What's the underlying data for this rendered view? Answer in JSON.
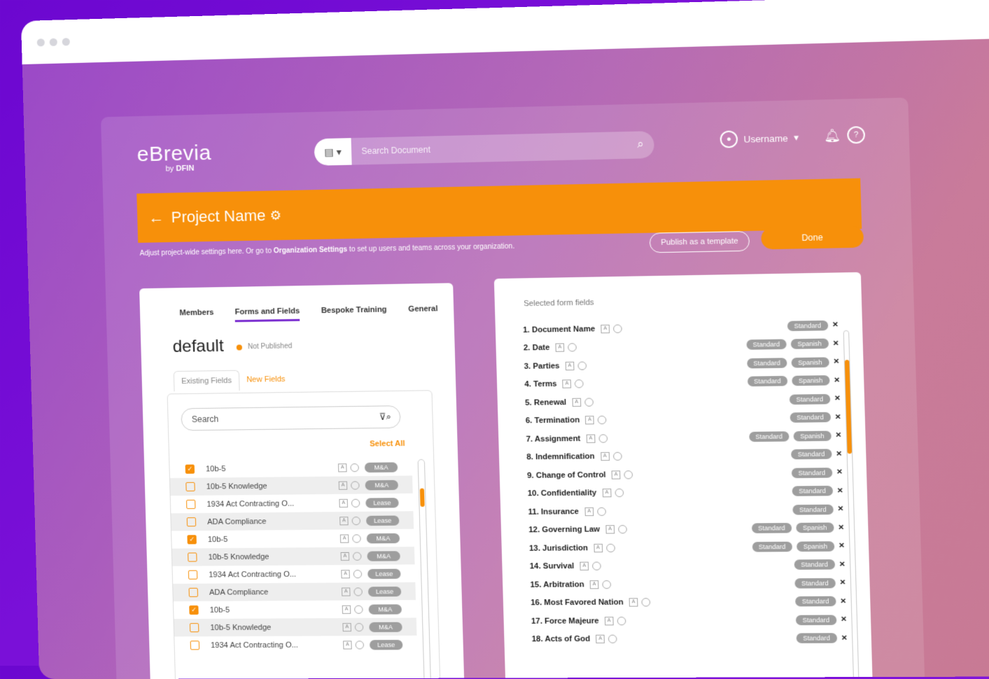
{
  "app": {
    "logo_main": "eBrevia",
    "logo_by": "by",
    "logo_brand": "DFIN"
  },
  "search": {
    "placeholder": "Search Document"
  },
  "user": {
    "name": "Username"
  },
  "project": {
    "name": "Project Name"
  },
  "hint": {
    "before": "Adjust project-wide settings here. Or go to ",
    "link": "Organization Settings",
    "after": " to set up users and teams across your organization."
  },
  "buttons": {
    "publish": "Publish as a template",
    "done": "Done"
  },
  "tabs": [
    "Members",
    "Forms and Fields",
    "Bespoke Training",
    "General"
  ],
  "form": {
    "name": "default",
    "status": "Not Published"
  },
  "subtabs": {
    "existing": "Existing Fields",
    "new": "New Fields"
  },
  "left_search": {
    "placeholder": "Search"
  },
  "select_all": "Select All",
  "fields_list": [
    {
      "label": "10b-5",
      "checked": true,
      "tag": "M&A"
    },
    {
      "label": "10b-5 Knowledge",
      "checked": false,
      "tag": "M&A"
    },
    {
      "label": "1934 Act Contracting O...",
      "checked": false,
      "tag": "Lease"
    },
    {
      "label": "ADA Compliance",
      "checked": false,
      "tag": "Lease"
    },
    {
      "label": "10b-5",
      "checked": true,
      "tag": "M&A"
    },
    {
      "label": "10b-5 Knowledge",
      "checked": false,
      "tag": "M&A"
    },
    {
      "label": "1934 Act Contracting O...",
      "checked": false,
      "tag": "Lease"
    },
    {
      "label": "ADA Compliance",
      "checked": false,
      "tag": "Lease"
    },
    {
      "label": "10b-5",
      "checked": true,
      "tag": "M&A"
    },
    {
      "label": "10b-5 Knowledge",
      "checked": false,
      "tag": "M&A"
    },
    {
      "label": "1934 Act Contracting O...",
      "checked": false,
      "tag": "Lease"
    }
  ],
  "selected": {
    "title": "Selected form fields",
    "items": [
      {
        "label": "1. Document Name",
        "tags": [
          "Standard"
        ]
      },
      {
        "label": "2. Date",
        "tags": [
          "Standard",
          "Spanish"
        ]
      },
      {
        "label": "3. Parties",
        "tags": [
          "Standard",
          "Spanish"
        ]
      },
      {
        "label": "4. Terms",
        "tags": [
          "Standard",
          "Spanish"
        ]
      },
      {
        "label": "5. Renewal",
        "tags": [
          "Standard"
        ]
      },
      {
        "label": "6. Termination",
        "tags": [
          "Standard"
        ]
      },
      {
        "label": "7. Assignment",
        "tags": [
          "Standard",
          "Spanish"
        ]
      },
      {
        "label": "8. Indemnification",
        "tags": [
          "Standard"
        ]
      },
      {
        "label": "9. Change of Control",
        "tags": [
          "Standard"
        ]
      },
      {
        "label": "10. Confidentiality",
        "tags": [
          "Standard"
        ]
      },
      {
        "label": "11. Insurance",
        "tags": [
          "Standard"
        ]
      },
      {
        "label": "12. Governing Law",
        "tags": [
          "Standard",
          "Spanish"
        ]
      },
      {
        "label": "13. Jurisdiction",
        "tags": [
          "Standard",
          "Spanish"
        ]
      },
      {
        "label": "14. Survival",
        "tags": [
          "Standard"
        ]
      },
      {
        "label": "15. Arbitration",
        "tags": [
          "Standard"
        ]
      },
      {
        "label": "16. Most Favored Nation",
        "tags": [
          "Standard"
        ]
      },
      {
        "label": "17. Force Majeure",
        "tags": [
          "Standard"
        ]
      },
      {
        "label": "18. Acts of God",
        "tags": [
          "Standard"
        ]
      }
    ]
  },
  "colors": {
    "accent": "#f7900a",
    "purple": "#7b2fd0"
  }
}
